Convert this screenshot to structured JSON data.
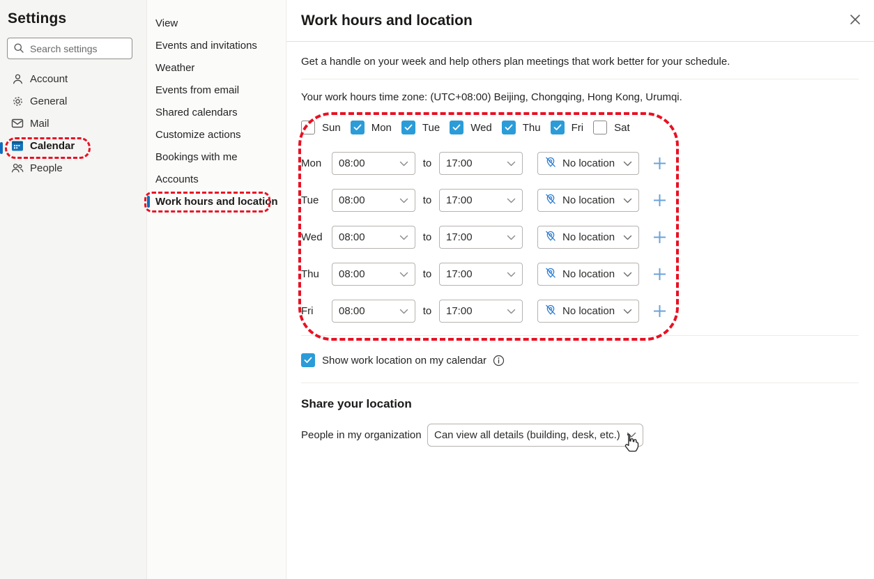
{
  "accent_colors": {
    "checkbox_blue": "#2b9cd8",
    "calendar_icon_blue": "#1272b8",
    "selection_bar_blue": "#0f6cbd",
    "annotation_red": "#e81123",
    "plus_blue": "#69a3d9",
    "location_icon_blue": "#2b7cd3"
  },
  "sidebar": {
    "title": "Settings",
    "search": {
      "placeholder": "Search settings"
    },
    "items": [
      {
        "label": "Account"
      },
      {
        "label": "General"
      },
      {
        "label": "Mail"
      },
      {
        "label": "Calendar"
      },
      {
        "label": "People"
      }
    ]
  },
  "nav": {
    "items": [
      {
        "label": "View"
      },
      {
        "label": "Events and invitations"
      },
      {
        "label": "Weather"
      },
      {
        "label": "Events from email"
      },
      {
        "label": "Shared calendars"
      },
      {
        "label": "Customize actions"
      },
      {
        "label": "Bookings with me"
      },
      {
        "label": "Accounts"
      },
      {
        "label": "Work hours and location"
      }
    ],
    "selected": "Work hours and location"
  },
  "main": {
    "title": "Work hours and location",
    "description": "Get a handle on your week and help others plan meetings that work better for your schedule.",
    "timezone_text": "Your work hours time zone: (UTC+08:00) Beijing, Chongqing, Hong Kong, Urumqi.",
    "to_label": "to",
    "week_days": [
      {
        "label": "Sun",
        "checked": false
      },
      {
        "label": "Mon",
        "checked": true
      },
      {
        "label": "Tue",
        "checked": true
      },
      {
        "label": "Wed",
        "checked": true
      },
      {
        "label": "Thu",
        "checked": true
      },
      {
        "label": "Fri",
        "checked": true
      },
      {
        "label": "Sat",
        "checked": false
      }
    ],
    "work_hours_rows": [
      {
        "day": "Mon",
        "start": "08:00",
        "end": "17:00",
        "location": "No location"
      },
      {
        "day": "Tue",
        "start": "08:00",
        "end": "17:00",
        "location": "No location"
      },
      {
        "day": "Wed",
        "start": "08:00",
        "end": "17:00",
        "location": "No location"
      },
      {
        "day": "Thu",
        "start": "08:00",
        "end": "17:00",
        "location": "No location"
      },
      {
        "day": "Fri",
        "start": "08:00",
        "end": "17:00",
        "location": "No location"
      }
    ],
    "show_location": {
      "label": "Show work location on my calendar",
      "checked": true
    },
    "share": {
      "heading": "Share your location",
      "org_label": "People in my organization",
      "org_value": "Can view all details (building, desk, etc.)"
    }
  }
}
